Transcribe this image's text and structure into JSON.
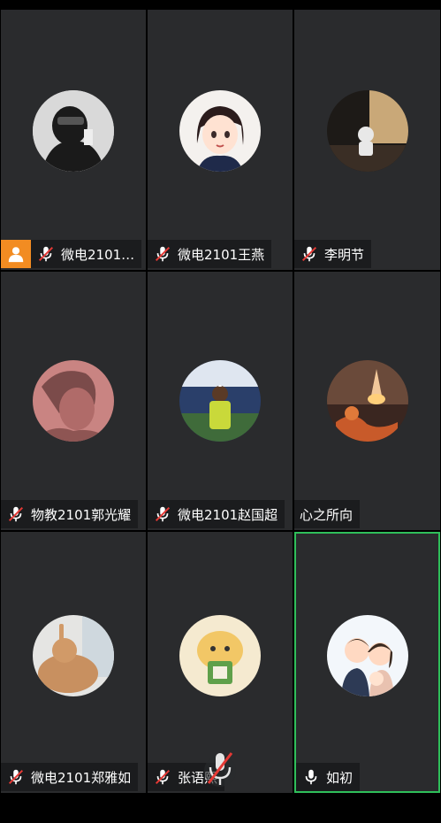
{
  "participants": [
    {
      "name": "微电2101…",
      "mic": "muted",
      "host": true
    },
    {
      "name": "微电2101王燕",
      "mic": "muted"
    },
    {
      "name": "李明节",
      "mic": "muted"
    },
    {
      "name": "物教2101郭光耀",
      "mic": "muted"
    },
    {
      "name": "微电2101赵国超",
      "mic": "muted"
    },
    {
      "name": "心之所向",
      "mic": "none"
    },
    {
      "name": "微电2101郑雅如",
      "mic": "muted"
    },
    {
      "name": "张语熙",
      "mic": "muted"
    },
    {
      "name": "如初",
      "mic": "on",
      "active": true
    }
  ],
  "colors": {
    "tile_bg": "#2a2b2d",
    "label_bg": "#1b1c1e",
    "host_badge": "#f28c22",
    "active_border": "#2fbf5a",
    "muted_slash": "#e53935"
  },
  "icons": {
    "host": "person-icon",
    "muted": "mic-muted-icon",
    "mic_on": "mic-icon",
    "bottom": "mic-muted-icon"
  }
}
